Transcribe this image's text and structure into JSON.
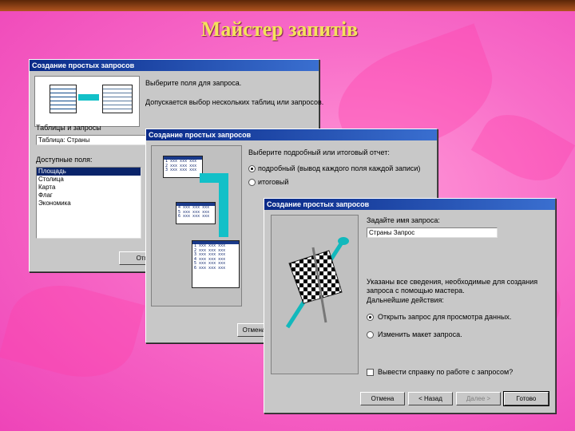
{
  "slide": {
    "title": "Майстер запитів"
  },
  "dialog1": {
    "title": "Создание простых запросов",
    "line1": "Выберите поля для запроса.",
    "line2": "Допускается выбор нескольких таблиц или запросов.",
    "tables_label": "Таблицы и запросы",
    "tables_value": "Таблица: Страны",
    "fields_label": "Доступные поля:",
    "fields": [
      "Площадь",
      "Столица",
      "Карта",
      "Флаг",
      "Экономика"
    ],
    "cancel_button": "Отмена"
  },
  "dialog2": {
    "title": "Создание простых запросов",
    "question": "Выберите подробный или итоговый отчет:",
    "opt_detailed": "подробный (вывод каждого поля каждой записи)",
    "opt_summary": "итоговый",
    "sheet_rows": [
      "1 ххх ххх ххх",
      "2 ххх ххх ххх",
      "3 ххх ххх ххх",
      "4 ххх ххх ххх",
      "5 ххх ххх ххх",
      "6 ххх ххх ххх"
    ],
    "cancel_button": "Отмена"
  },
  "dialog3": {
    "title": "Создание простых запросов",
    "name_label": "Задайте имя запроса:",
    "name_value": "Страны Запрос",
    "info_line1": "Указаны все сведения, необходимые для создания",
    "info_line2": "запроса с помощью мастера.",
    "next_action_label": "Дальнейшие действия:",
    "opt_open": "Открыть запрос для просмотра данных.",
    "opt_modify": "Изменить макет запроса.",
    "help_check": "Вывести справку по работе с запросом?",
    "buttons": {
      "cancel": "Отмена",
      "back": "< Назад",
      "next": "Далее >",
      "finish": "Готово"
    }
  }
}
